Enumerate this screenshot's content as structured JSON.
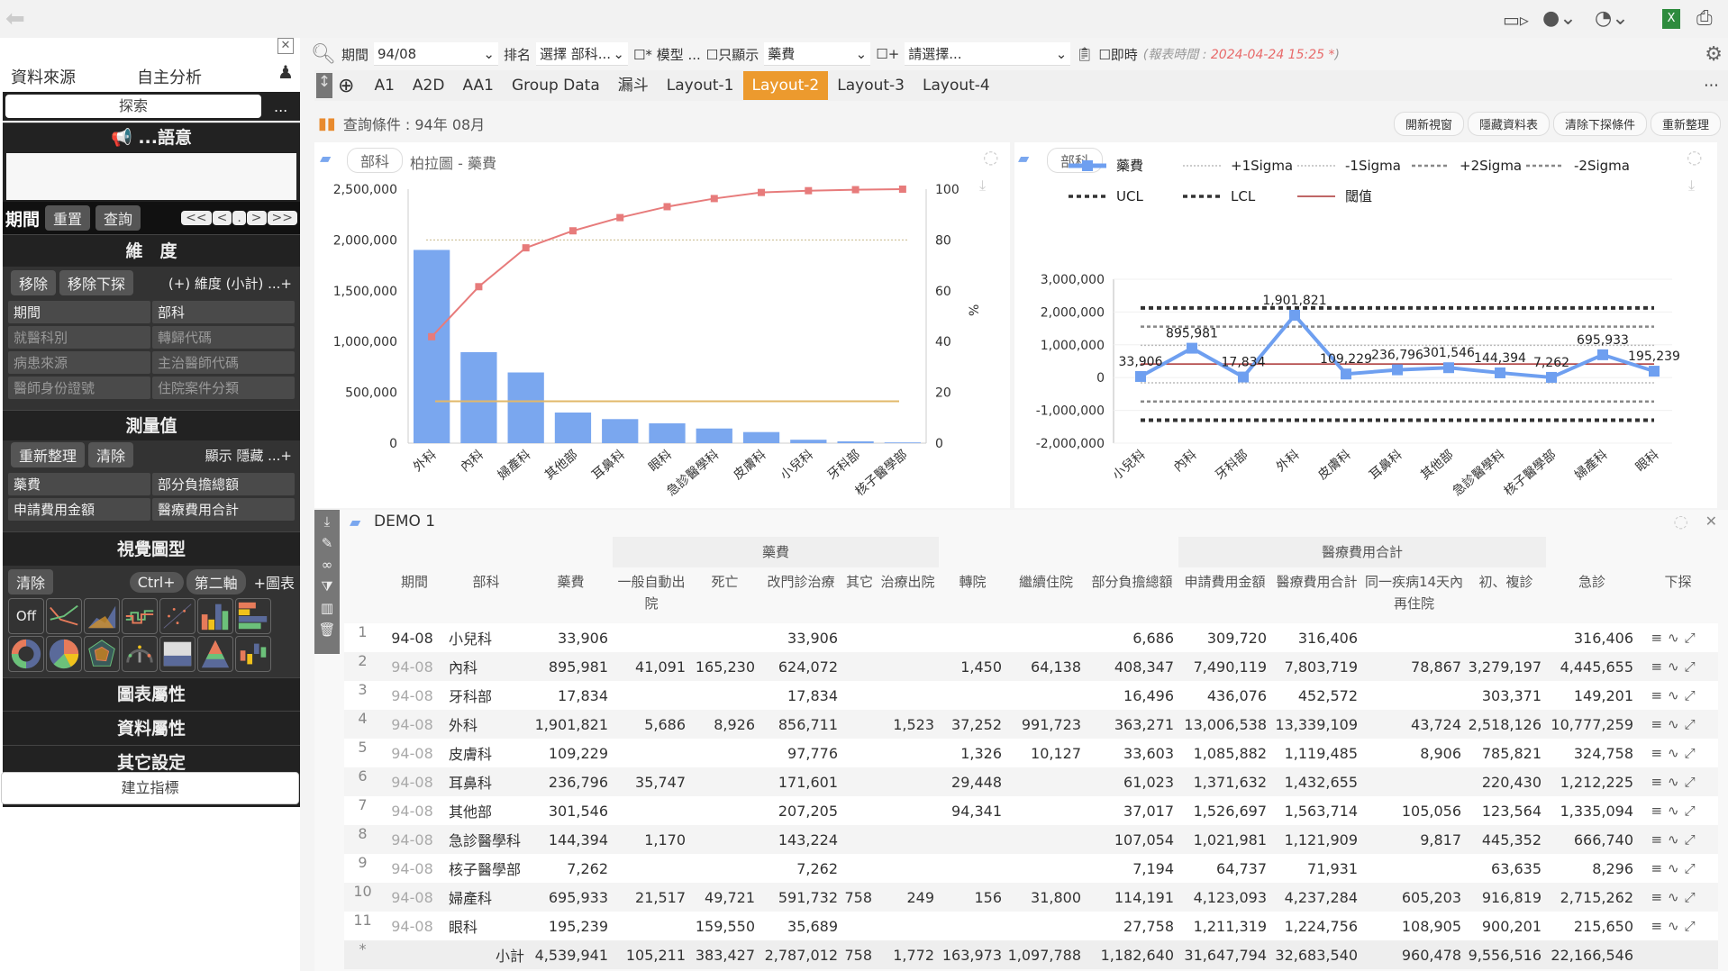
{
  "topbar": {
    "icons": [
      "back-arrow-icon",
      "video-icon",
      "chat-icon",
      "dashboard-icon",
      "excel-icon",
      "print-icon"
    ]
  },
  "sidebar": {
    "tabs": [
      "資料來源",
      "自主分析"
    ],
    "search_label": "探索",
    "more": "...",
    "semantic_title": "...語意",
    "period_label": "期間",
    "reset": "重置",
    "query": "查詢",
    "nav": [
      "<<",
      "<",
      ".",
      ">",
      ">>"
    ],
    "dim_title": "維　度",
    "remove": "移除",
    "remove_drill": "移除下探",
    "dim_add": "(+) 維度 (小計) ...+",
    "dims": [
      [
        "期間",
        "部科"
      ],
      [
        "就醫科別",
        "轉歸代碼"
      ],
      [
        "病患來源",
        "主治醫師代碼"
      ],
      [
        "醫師身份證號",
        "住院案件分類"
      ]
    ],
    "measure_title": "測量值",
    "refresh": "重新整理",
    "clear": "清除",
    "show_hide": "顯示 隱藏 ...+",
    "measures": [
      [
        "藥費",
        "部分負擔總額"
      ],
      [
        "申請費用金額",
        "醫療費用合計"
      ]
    ],
    "visual_title": "視覺圖型",
    "vclear": "清除",
    "ctrl": "Ctrl+",
    "second_axis": "第二軸",
    "add_chart": "+圖表",
    "chart_off": "Off",
    "chart_props": "圖表屬性",
    "data_props": "資料屬性",
    "other_settings": "其它設定",
    "create_metric": "建立指標"
  },
  "toolbar": {
    "period_label": "期間",
    "period_value": "94/08",
    "rank_label": "排名",
    "rank_value": "選擇 部科...",
    "model_label": "* 模型 ...",
    "only_show": "只顯示",
    "measure_value": "藥費",
    "plus": "+",
    "select_placeholder": "請選擇...",
    "realtime": "即時",
    "report_time_label": "(報表時間 : ",
    "report_time": "2024-04-24 15:25 *",
    ")": ")"
  },
  "tabs": {
    "items": [
      "A1",
      "A2D",
      "AA1",
      "Group Data",
      "漏斗",
      "Layout-1",
      "Layout-2",
      "Layout-3",
      "Layout-4"
    ],
    "active": "Layout-2"
  },
  "query": {
    "text": "查詢條件 : 94年 08月",
    "buttons": [
      "開新視窗",
      "隱藏資料表",
      "清除下探條件",
      "重新整理"
    ]
  },
  "charts": {
    "left_tag": "部科",
    "left_title": "柏拉圖 - 藥費",
    "right_tag": "部科"
  },
  "chart_data": [
    {
      "type": "bar",
      "subtype": "pareto",
      "categories": [
        "外科",
        "內科",
        "婦產科",
        "其他部",
        "耳鼻科",
        "眼科",
        "急診醫學科",
        "皮膚科",
        "小兒科",
        "牙科部",
        "核子醫學部"
      ],
      "values": [
        1901821,
        895981,
        695933,
        301546,
        236796,
        195239,
        144394,
        109229,
        33906,
        17834,
        7262
      ],
      "cumulative_percent": [
        41.9,
        61.6,
        76.9,
        83.6,
        88.8,
        93.1,
        96.3,
        98.7,
        99.4,
        99.8,
        100
      ],
      "mean_line": 412722,
      "reference_percent": 80,
      "ylim": [
        0,
        2500000
      ],
      "yticks": [
        "0",
        "500,000",
        "1,000,000",
        "1,500,000",
        "2,000,000",
        "2,500,000"
      ],
      "y2lim": [
        0,
        100
      ],
      "y2ticks": [
        "0",
        "20",
        "40",
        "60",
        "80",
        "100"
      ],
      "y2label": "%",
      "colors": {
        "bar": "#7aa7ef",
        "cumulative": "#e77b7b",
        "mean": "#e2b86a",
        "ref": "#c8b98a"
      },
      "grid": false
    },
    {
      "type": "line",
      "subtype": "control-chart",
      "categories": [
        "小兒科",
        "內科",
        "牙科部",
        "外科",
        "皮膚科",
        "耳鼻科",
        "其他部",
        "急診醫學科",
        "核子醫學部",
        "婦產科",
        "眼科"
      ],
      "series": [
        {
          "name": "藥費",
          "values": [
            33906,
            895981,
            17834,
            1901821,
            109229,
            236796,
            301546,
            144394,
            7262,
            695933,
            195239
          ],
          "color": "#6e9ff0"
        }
      ],
      "labels": [
        "33,906",
        "895,981",
        "17,834",
        "1,901,821",
        "109,229",
        "236,796",
        "301,546",
        "144,394",
        "7,262",
        "695,933",
        "195,239"
      ],
      "limits": [
        {
          "name": "+1Sigma",
          "value": 985000,
          "style": "dot-light"
        },
        {
          "name": "-1Sigma",
          "value": -160000,
          "style": "dot-light"
        },
        {
          "name": "+2Sigma",
          "value": 1555000,
          "style": "dash-mid"
        },
        {
          "name": "-2Sigma",
          "value": -730000,
          "style": "dash-mid"
        },
        {
          "name": "UCL",
          "value": 2125000,
          "style": "dash-dark"
        },
        {
          "name": "LCL",
          "value": -1300000,
          "style": "dash-dark"
        },
        {
          "name": "閾值",
          "value": 412722,
          "style": "solid-red"
        }
      ],
      "ylim": [
        -2000000,
        3000000
      ],
      "yticks": [
        "-2,000,000",
        "-1,000,000",
        "0",
        "1,000,000",
        "2,000,000",
        "3,000,000"
      ],
      "legend": "top"
    }
  ],
  "table": {
    "title": "DEMO 1",
    "groups": [
      {
        "label": "藥費"
      },
      {
        "label": "醫療費用合計"
      }
    ],
    "columns": [
      "期間",
      "部科",
      "藥費",
      "一般自動出院",
      "死亡",
      "改門診治療",
      "其它",
      "治療出院",
      "轉院",
      "繼續住院",
      "部分負擔總額",
      "申請費用金額",
      "醫療費用合計",
      "同一疾病14天內再住院",
      "初、複診",
      "急診",
      "下探"
    ],
    "rows": [
      [
        "1",
        "94-08",
        "小兒科",
        "33,906",
        "",
        "",
        "33,906",
        "",
        "",
        "",
        "",
        "6,686",
        "309,720",
        "316,406",
        "",
        "",
        "316,406"
      ],
      [
        "2",
        "94-08",
        "內科",
        "895,981",
        "41,091",
        "165,230",
        "624,072",
        "",
        "",
        "1,450",
        "64,138",
        "408,347",
        "7,490,119",
        "7,803,719",
        "78,867",
        "3,279,197",
        "4,445,655"
      ],
      [
        "3",
        "94-08",
        "牙科部",
        "17,834",
        "",
        "",
        "17,834",
        "",
        "",
        "",
        "",
        "16,496",
        "436,076",
        "452,572",
        "",
        "303,371",
        "149,201"
      ],
      [
        "4",
        "94-08",
        "外科",
        "1,901,821",
        "5,686",
        "8,926",
        "856,711",
        "",
        "1,523",
        "37,252",
        "991,723",
        "363,271",
        "13,006,538",
        "13,339,109",
        "43,724",
        "2,518,126",
        "10,777,259"
      ],
      [
        "5",
        "94-08",
        "皮膚科",
        "109,229",
        "",
        "",
        "97,776",
        "",
        "",
        "1,326",
        "10,127",
        "33,603",
        "1,085,882",
        "1,119,485",
        "8,906",
        "785,821",
        "324,758"
      ],
      [
        "6",
        "94-08",
        "耳鼻科",
        "236,796",
        "35,747",
        "",
        "171,601",
        "",
        "",
        "29,448",
        "",
        "61,023",
        "1,371,632",
        "1,432,655",
        "",
        "220,430",
        "1,212,225"
      ],
      [
        "7",
        "94-08",
        "其他部",
        "301,546",
        "",
        "",
        "207,205",
        "",
        "",
        "94,341",
        "",
        "37,017",
        "1,526,697",
        "1,563,714",
        "105,056",
        "123,564",
        "1,335,094"
      ],
      [
        "8",
        "94-08",
        "急診醫學科",
        "144,394",
        "1,170",
        "",
        "143,224",
        "",
        "",
        "",
        "",
        "107,054",
        "1,021,981",
        "1,121,909",
        "9,817",
        "445,352",
        "666,740"
      ],
      [
        "9",
        "94-08",
        "核子醫學部",
        "7,262",
        "",
        "",
        "7,262",
        "",
        "",
        "",
        "",
        "7,194",
        "64,737",
        "71,931",
        "",
        "63,635",
        "8,296"
      ],
      [
        "10",
        "94-08",
        "婦產科",
        "695,933",
        "21,517",
        "49,721",
        "591,732",
        "758",
        "249",
        "156",
        "31,800",
        "114,191",
        "4,123,093",
        "4,237,284",
        "605,203",
        "916,819",
        "2,715,262"
      ],
      [
        "11",
        "94-08",
        "眼科",
        "195,239",
        "",
        "159,550",
        "35,689",
        "",
        "",
        "",
        "",
        "27,758",
        "1,211,319",
        "1,224,756",
        "108,905",
        "900,201",
        "215,650"
      ]
    ],
    "subtotal": [
      "*",
      "",
      "小計",
      "4,539,941",
      "105,211",
      "383,427",
      "2,787,012",
      "758",
      "1,772",
      "163,973",
      "1,097,788",
      "1,182,640",
      "31,647,794",
      "32,683,540",
      "960,478",
      "9,556,516",
      "22,166,546"
    ],
    "row_actions": [
      "≡",
      "∿",
      "⤢"
    ]
  }
}
